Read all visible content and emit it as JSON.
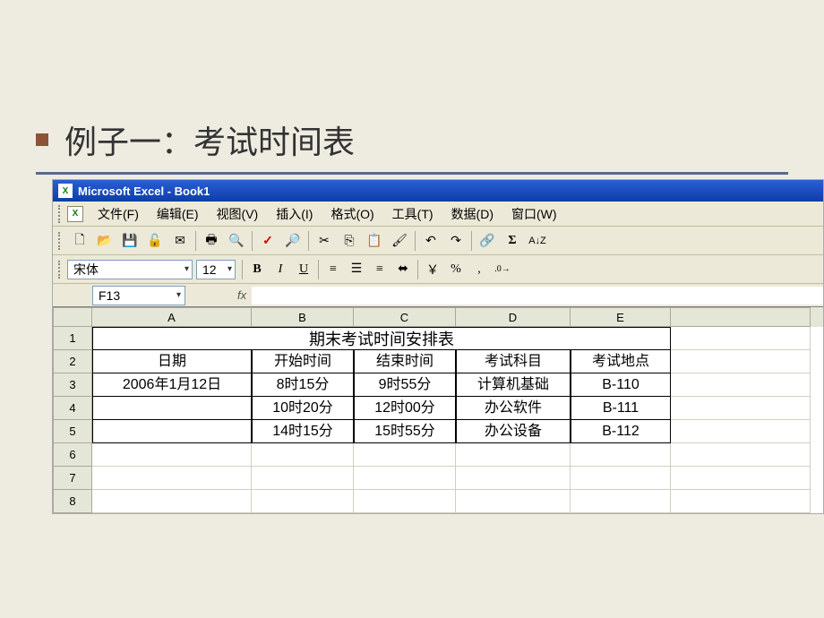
{
  "slide": {
    "title": "例子一：考试时间表"
  },
  "window": {
    "title": "Microsoft Excel - Book1"
  },
  "menus": {
    "file": "文件(F)",
    "edit": "编辑(E)",
    "view": "视图(V)",
    "insert": "插入(I)",
    "format": "格式(O)",
    "tools": "工具(T)",
    "data": "数据(D)",
    "window": "窗口(W)"
  },
  "format": {
    "font_name": "宋体",
    "font_size": "12",
    "bold": "B",
    "italic": "I",
    "underline": "U",
    "percent": "%",
    "comma": ",",
    "decimal_inc": ".0",
    "currency": "￥"
  },
  "namebox": {
    "cell_ref": "F13",
    "fx": "fx"
  },
  "columns": {
    "A": "A",
    "B": "B",
    "C": "C",
    "D": "D",
    "E": "E"
  },
  "rows": {
    "1": "1",
    "2": "2",
    "3": "3",
    "4": "4",
    "5": "5",
    "6": "6",
    "7": "7",
    "8": "8"
  },
  "sheet": {
    "title": "期末考试时间安排表",
    "headers": {
      "date": "日期",
      "start": "开始时间",
      "end": "结束时间",
      "subject": "考试科目",
      "location": "考试地点"
    },
    "r3": {
      "A": "2006年1月12日",
      "B": "8时15分",
      "C": "9时55分",
      "D": "计算机基础",
      "E": "B-110"
    },
    "r4": {
      "A": "",
      "B": "10时20分",
      "C": "12时00分",
      "D": "办公软件",
      "E": "B-111"
    },
    "r5": {
      "A": "",
      "B": "14时15分",
      "C": "15时55分",
      "D": "办公设备",
      "E": "B-112"
    }
  }
}
